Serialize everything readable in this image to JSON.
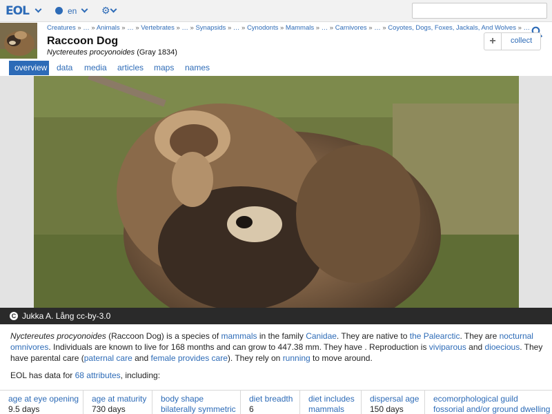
{
  "topbar": {
    "logo": "EOL",
    "language": "en",
    "search_placeholder": ""
  },
  "header": {
    "breadcrumbs": [
      "Creatures",
      "…",
      "Animals",
      "…",
      "Vertebrates",
      "…",
      "Synapsids",
      "…",
      "Cynodonts",
      "Mammals",
      "…",
      "Carnivores",
      "…",
      "Coyotes, Dogs, Foxes, Jackals, And Wolves",
      "…"
    ],
    "title": "Raccoon Dog",
    "scientific_name": "Nyctereutes procyonoides",
    "authority": "(Gray 1834)",
    "collect_plus": "+",
    "collect_label": "collect"
  },
  "tabs": [
    {
      "label": "overview",
      "active": true
    },
    {
      "label": "data",
      "active": false
    },
    {
      "label": "media",
      "active": false
    },
    {
      "label": "articles",
      "active": false
    },
    {
      "label": "maps",
      "active": false
    },
    {
      "label": "names",
      "active": false
    }
  ],
  "image": {
    "credit_icon": "C",
    "author": "Jukka A. Lång",
    "license": "cc-by-3.0"
  },
  "description": {
    "s1": "Nyctereutes procyonoides",
    "s2": " (Raccoon Dog) is a species of ",
    "l_mammals": "mammals",
    "s3": " in the family ",
    "l_canidae": "Canidae",
    "s4": ". They are native to ",
    "l_palearctic": "the Palearctic",
    "s5": ". They are ",
    "l_omnivores": "nocturnal omnivores",
    "s6": ". Individuals are known to live for 168 months and can grow to 447.38 mm. They have . Reproduction is ",
    "l_viviparous": "viviparous",
    "s7": " and ",
    "l_dioecious": "dioecious",
    "s8": ". They have parental care (",
    "l_paternal": "paternal care",
    "s9": " and ",
    "l_female": "female provides care",
    "s10": "). They rely on ",
    "l_running": "running",
    "s11": " to move around."
  },
  "attributes_intro": {
    "before": "EOL has data for ",
    "count": "68 attributes",
    "after": ", including:"
  },
  "attributes": [
    {
      "name": "age at eye opening",
      "value": "9.5 days",
      "value_is_link": false
    },
    {
      "name": "age at maturity",
      "value": "730 days",
      "value_is_link": false
    },
    {
      "name": "body shape",
      "value": "bilaterally symmetric",
      "value_is_link": true
    },
    {
      "name": "diet breadth",
      "value": "6",
      "value_is_link": false
    },
    {
      "name": "diet includes",
      "value": "mammals",
      "value_is_link": true
    },
    {
      "name": "dispersal age",
      "value": "150 days",
      "value_is_link": false
    },
    {
      "name": "ecomorphological guild",
      "value": "fossorial and/or ground dwelling",
      "value_is_link": true
    }
  ],
  "colors": {
    "link": "#2d6bb7",
    "tab_active_bg": "#2d6bb7",
    "credit_bar": "#2a2a2a",
    "topbar": "#f2f2f2"
  },
  "icons": [
    "logo-chevron-down-icon",
    "globe-icon",
    "chevron-down-icon",
    "gear-icon",
    "search-icon",
    "plus-icon",
    "cc-icon"
  ]
}
